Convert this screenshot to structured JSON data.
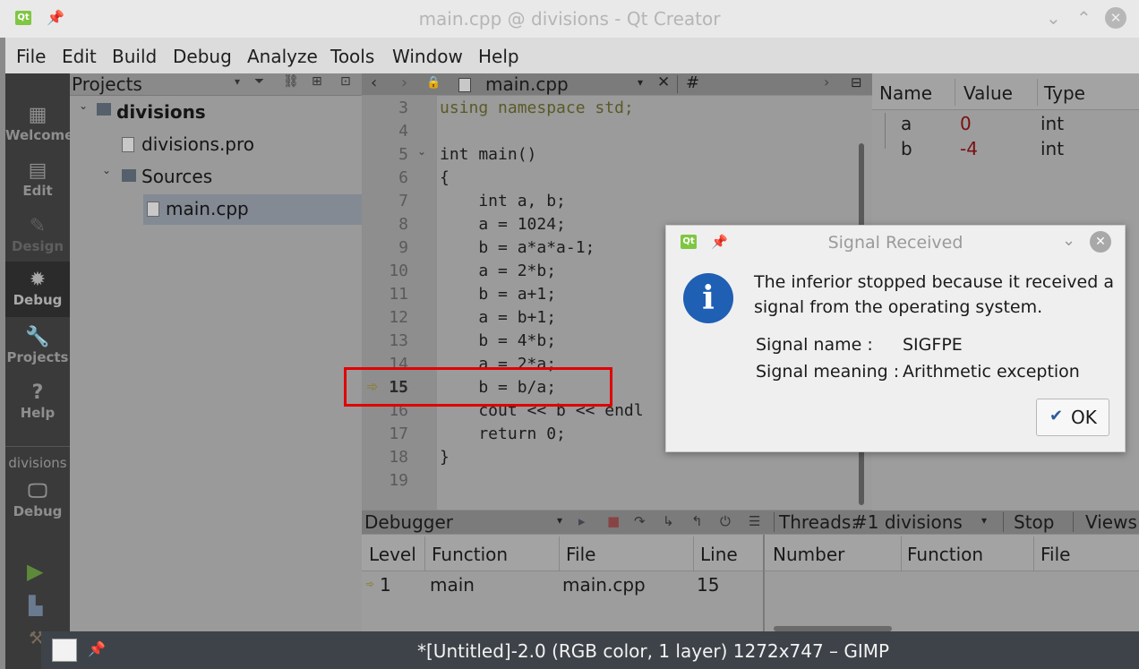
{
  "window": {
    "title": "main.cpp @ divisions - Qt Creator"
  },
  "menu": [
    "File",
    "Edit",
    "Build",
    "Debug",
    "Analyze",
    "Tools",
    "Window",
    "Help"
  ],
  "modes": [
    {
      "label": "Welcome",
      "icon": "grid-icon"
    },
    {
      "label": "Edit",
      "icon": "document-icon"
    },
    {
      "label": "Design",
      "icon": "pencil-icon"
    },
    {
      "label": "Debug",
      "icon": "bug-icon"
    },
    {
      "label": "Projects",
      "icon": "wrench-icon"
    },
    {
      "label": "Help",
      "icon": "question-icon"
    }
  ],
  "kit": {
    "project": "divisions",
    "config": "Debug"
  },
  "projects": {
    "header": "Projects",
    "tree": [
      "divisions",
      "divisions.pro",
      "Sources",
      "main.cpp"
    ]
  },
  "editor": {
    "file": "main.cpp",
    "hash": "#",
    "lines": [
      {
        "n": "3",
        "text": "using namespace std;"
      },
      {
        "n": "4",
        "text": ""
      },
      {
        "n": "5",
        "text": "int main()"
      },
      {
        "n": "6",
        "text": "{"
      },
      {
        "n": "7",
        "text": "    int a, b;"
      },
      {
        "n": "8",
        "text": "    a = 1024;"
      },
      {
        "n": "9",
        "text": "    b = a*a*a-1;"
      },
      {
        "n": "10",
        "text": "    a = 2*b;"
      },
      {
        "n": "11",
        "text": "    b = a+1;"
      },
      {
        "n": "12",
        "text": "    a = b+1;"
      },
      {
        "n": "13",
        "text": "    b = 4*b;"
      },
      {
        "n": "14",
        "text": "    a = 2*a;"
      },
      {
        "n": "15",
        "text": "    b = b/a;"
      },
      {
        "n": "16",
        "text": "    cout << b << endl"
      },
      {
        "n": "17",
        "text": "    return 0;"
      },
      {
        "n": "18",
        "text": "}"
      },
      {
        "n": "19",
        "text": ""
      }
    ]
  },
  "locals": {
    "headers": [
      "Name",
      "Value",
      "Type"
    ],
    "rows": [
      {
        "name": "a",
        "value": "0",
        "type": "int"
      },
      {
        "name": "b",
        "value": "-4",
        "type": "int"
      }
    ]
  },
  "debugger": {
    "title": "Debugger",
    "threads": "Threads:",
    "thread_value": "#1 divisions",
    "stop": "Stop",
    "views": "Views",
    "stack_headers": [
      "Level",
      "Function",
      "File",
      "Line"
    ],
    "stack_row": {
      "level": "1",
      "function": "main",
      "file": "main.cpp",
      "line": "15"
    },
    "thread_headers": [
      "Number",
      "Function",
      "File"
    ]
  },
  "dialog": {
    "title": "Signal Received",
    "message1": "The inferior stopped because it received a",
    "message2": "signal from the operating system.",
    "signal_name_label": "Signal name :",
    "signal_name": "SIGFPE",
    "signal_meaning_label": "Signal meaning :",
    "signal_meaning": "Arithmetic exception",
    "ok": "OK"
  },
  "taskbar": {
    "title": "*[Untitled]-2.0 (RGB color, 1 layer) 1272x747 – GIMP"
  },
  "colors": {
    "highlight": "#e00000",
    "info_blue": "#1f5fb4",
    "qt_green": "#7fc642"
  }
}
